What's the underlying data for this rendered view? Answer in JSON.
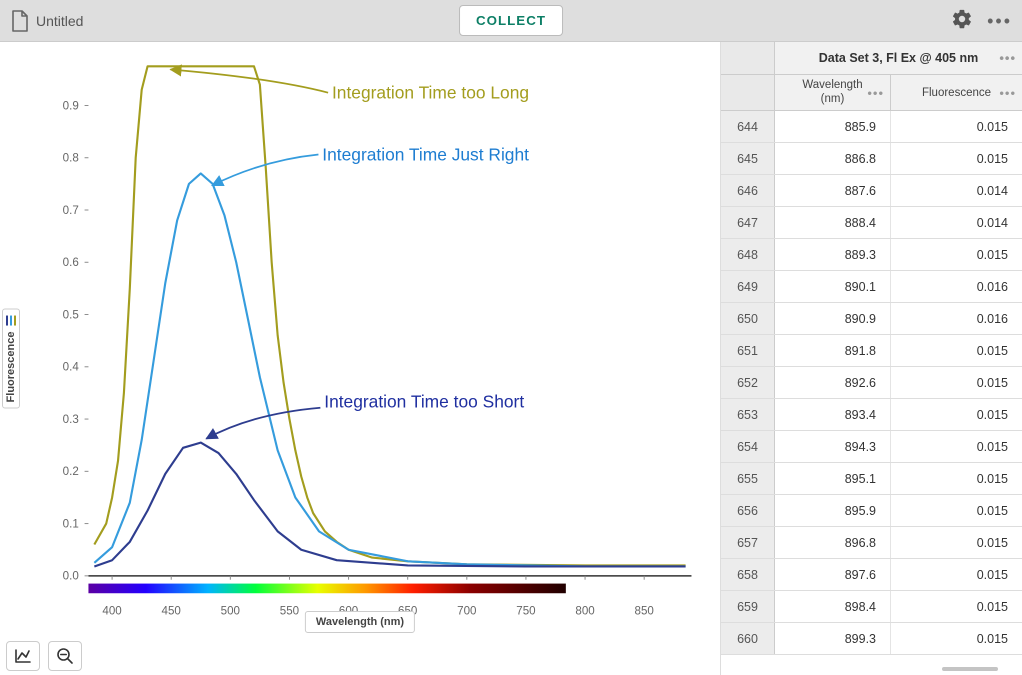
{
  "toolbar": {
    "file_title": "Untitled",
    "collect_label": "COLLECT"
  },
  "chart": {
    "y_axis_label": "Fluorescence",
    "x_axis_label": "Wavelength (nm)",
    "annotation_long": "Integration Time too Long",
    "annotation_right": "Integration Time Just Right",
    "annotation_short": "Integration Time too Short",
    "y_ticks": [
      "0.0",
      "0.1",
      "0.2",
      "0.3",
      "0.4",
      "0.5",
      "0.6",
      "0.7",
      "0.8",
      "0.9"
    ],
    "x_ticks": [
      "400",
      "450",
      "500",
      "550",
      "600",
      "650",
      "700",
      "750",
      "800",
      "850"
    ]
  },
  "chart_data": {
    "type": "line",
    "xlabel": "Wavelength (nm)",
    "ylabel": "Fluorescence",
    "xlim": [
      380,
      890
    ],
    "ylim": [
      0.0,
      0.98
    ],
    "series": [
      {
        "name": "Integration Time too Long",
        "color": "#a39d1e",
        "x": [
          385,
          395,
          400,
          405,
          410,
          415,
          420,
          425,
          430,
          435,
          440,
          520,
          525,
          530,
          535,
          540,
          545,
          550,
          555,
          560,
          565,
          570,
          580,
          590,
          600,
          620,
          650,
          700,
          800,
          885
        ],
        "y": [
          0.06,
          0.1,
          0.15,
          0.22,
          0.35,
          0.55,
          0.8,
          0.93,
          0.975,
          0.975,
          0.975,
          0.975,
          0.94,
          0.78,
          0.6,
          0.46,
          0.37,
          0.3,
          0.24,
          0.19,
          0.15,
          0.12,
          0.085,
          0.065,
          0.05,
          0.035,
          0.028,
          0.022,
          0.02,
          0.02
        ]
      },
      {
        "name": "Integration Time Just Right",
        "color": "#359cdd",
        "x": [
          385,
          400,
          415,
          425,
          435,
          445,
          455,
          465,
          475,
          485,
          495,
          505,
          515,
          525,
          540,
          555,
          575,
          600,
          650,
          700,
          800,
          885
        ],
        "y": [
          0.025,
          0.055,
          0.14,
          0.26,
          0.41,
          0.56,
          0.68,
          0.75,
          0.77,
          0.75,
          0.69,
          0.6,
          0.49,
          0.38,
          0.24,
          0.15,
          0.085,
          0.05,
          0.028,
          0.022,
          0.018,
          0.018
        ]
      },
      {
        "name": "Integration Time too Short",
        "color": "#2e3d8f",
        "x": [
          385,
          400,
          415,
          430,
          445,
          460,
          475,
          490,
          505,
          520,
          540,
          560,
          590,
          650,
          750,
          885
        ],
        "y": [
          0.018,
          0.03,
          0.065,
          0.125,
          0.195,
          0.245,
          0.255,
          0.235,
          0.195,
          0.145,
          0.085,
          0.05,
          0.03,
          0.02,
          0.018,
          0.018
        ]
      }
    ],
    "annotations": [
      {
        "text": "Integration Time too Long",
        "target_xy": [
          440,
          0.975
        ],
        "color": "#a39d1e"
      },
      {
        "text": "Integration Time Just Right",
        "target_xy": [
          475,
          0.77
        ],
        "color": "#359cdd"
      },
      {
        "text": "Integration Time too Short",
        "target_xy": [
          475,
          0.255
        ],
        "color": "#2e3d8f"
      }
    ]
  },
  "table": {
    "dataset_title": "Data Set 3, Fl Ex @ 405 nm",
    "col_wavelength": "Wavelength (nm)",
    "col_fluorescence": "Fluorescence",
    "rows": [
      {
        "idx": "644",
        "wl": "885.9",
        "fl": "0.015"
      },
      {
        "idx": "645",
        "wl": "886.8",
        "fl": "0.015"
      },
      {
        "idx": "646",
        "wl": "887.6",
        "fl": "0.014"
      },
      {
        "idx": "647",
        "wl": "888.4",
        "fl": "0.014"
      },
      {
        "idx": "648",
        "wl": "889.3",
        "fl": "0.015"
      },
      {
        "idx": "649",
        "wl": "890.1",
        "fl": "0.016"
      },
      {
        "idx": "650",
        "wl": "890.9",
        "fl": "0.016"
      },
      {
        "idx": "651",
        "wl": "891.8",
        "fl": "0.015"
      },
      {
        "idx": "652",
        "wl": "892.6",
        "fl": "0.015"
      },
      {
        "idx": "653",
        "wl": "893.4",
        "fl": "0.015"
      },
      {
        "idx": "654",
        "wl": "894.3",
        "fl": "0.015"
      },
      {
        "idx": "655",
        "wl": "895.1",
        "fl": "0.015"
      },
      {
        "idx": "656",
        "wl": "895.9",
        "fl": "0.015"
      },
      {
        "idx": "657",
        "wl": "896.8",
        "fl": "0.015"
      },
      {
        "idx": "658",
        "wl": "897.6",
        "fl": "0.015"
      },
      {
        "idx": "659",
        "wl": "898.4",
        "fl": "0.015"
      },
      {
        "idx": "660",
        "wl": "899.3",
        "fl": "0.015"
      }
    ]
  }
}
